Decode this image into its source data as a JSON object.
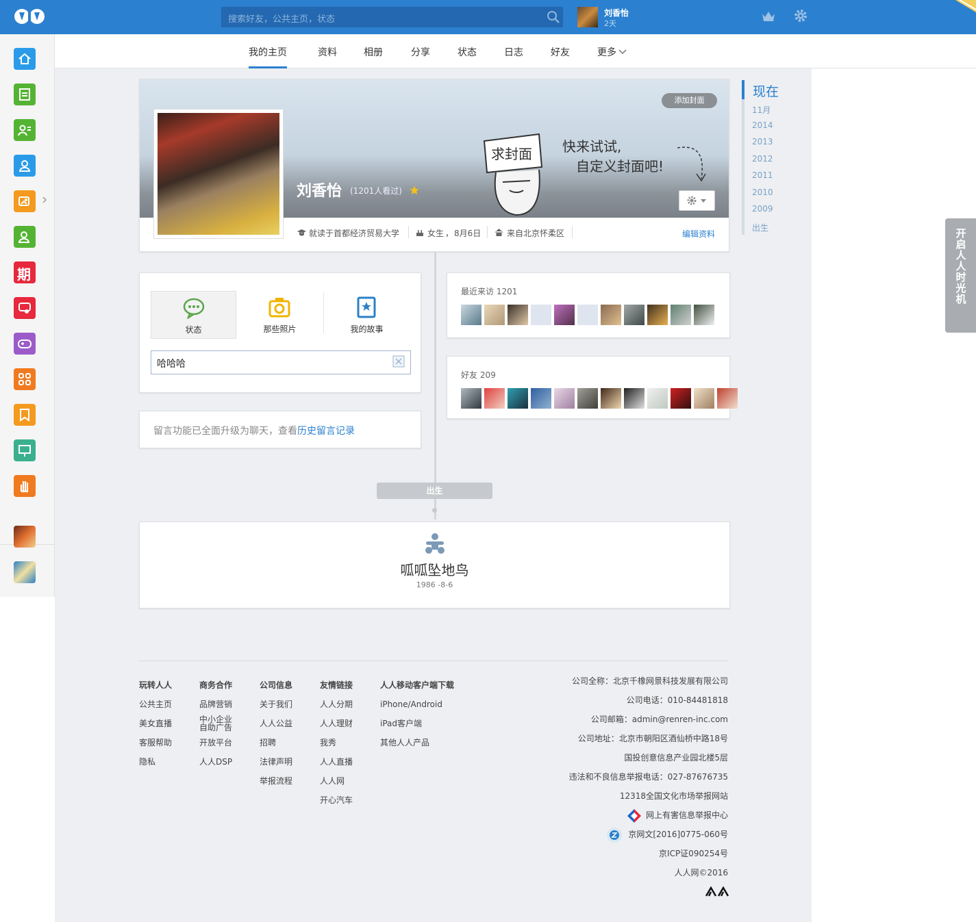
{
  "header": {
    "search_placeholder": "搜索好友，公共主页，状态",
    "user": {
      "name": "刘香怡",
      "status": "2天"
    }
  },
  "nav": {
    "tabs": [
      "我的主页",
      "资料",
      "相册",
      "分享",
      "状态",
      "日志",
      "好友",
      "更多"
    ],
    "active": "我的主页"
  },
  "sidebar": {
    "items": [
      {
        "icon": "home-icon",
        "color": "#2a9be8"
      },
      {
        "icon": "newsfeed-icon",
        "color": "#55b334"
      },
      {
        "icon": "profile-card-icon",
        "color": "#55b334"
      },
      {
        "icon": "friends-icon",
        "color": "#2a9be8"
      },
      {
        "icon": "photos-icon",
        "color": "#f39a1f"
      },
      {
        "icon": "contacts-icon",
        "color": "#55b334"
      },
      {
        "icon": "issue-icon",
        "color": "#e8283c",
        "label": "期"
      },
      {
        "icon": "message-icon",
        "color": "#e8283c"
      },
      {
        "icon": "game-icon",
        "color": "#9b5cc9"
      },
      {
        "icon": "apps-icon",
        "color": "#f07a1f"
      },
      {
        "icon": "bookmark-icon",
        "color": "#f39a1f"
      },
      {
        "icon": "present-icon",
        "color": "#3ab08e"
      },
      {
        "icon": "hand-icon",
        "color": "#f07a1f"
      },
      {
        "icon": "game-avatar-icon",
        "color": "#c0392b"
      },
      {
        "icon": "card-game-icon",
        "color": "#2a80c8"
      }
    ]
  },
  "cover": {
    "add_cover_label": "添加封面",
    "art_text_1": "求封面",
    "art_text_2": "快来试试,",
    "art_text_3": "自定义封面吧!",
    "name": "刘香怡",
    "views": "(1201人看过)",
    "info": {
      "school": "就读于首都经济贸易大学",
      "gender": "女生",
      "gender_sep": "，",
      "birthday": "8月6日",
      "hometown": "来自北京怀柔区"
    },
    "edit_label": "编辑资料"
  },
  "publisher": {
    "tabs": [
      {
        "label": "状态",
        "icon": "chat-bubble-icon"
      },
      {
        "label": "那些照片",
        "icon": "camera-icon"
      },
      {
        "label": "我的故事",
        "icon": "story-book-icon"
      }
    ],
    "input_value": "哈哈哈"
  },
  "message_notice": {
    "text": "留言功能已全面升级为聊天，查看",
    "link": "历史留言记录"
  },
  "visitors": {
    "title": "最近来访",
    "count": "1201"
  },
  "friends": {
    "title": "好友",
    "count": "209"
  },
  "birth": {
    "marker": "出生",
    "title": "呱呱坠地鸟",
    "date": "1986 -8-6"
  },
  "timeline_nav": {
    "now": "现在",
    "items": [
      "11月",
      "2014",
      "2013",
      "2012",
      "2011",
      "2010",
      "2009",
      "出生"
    ]
  },
  "side_tab": "开启人人时光机",
  "footer": {
    "columns": [
      {
        "heading": "玩转人人",
        "links": [
          "公共主页",
          "美女直播",
          "客服帮助",
          "隐私"
        ]
      },
      {
        "heading": "商务合作",
        "links": [
          "品牌营销",
          "中小企业 自助广告",
          "开放平台",
          "人人DSP"
        ]
      },
      {
        "heading": "公司信息",
        "links": [
          "关于我们",
          "人人公益",
          "招聘",
          "法律声明",
          "举报流程"
        ]
      },
      {
        "heading": "友情链接",
        "links": [
          "人人分期",
          "人人理财",
          "我秀",
          "人人直播",
          "人人网",
          "开心汽车"
        ]
      },
      {
        "heading": "人人移动客户端下载",
        "links": [
          "iPhone/Android",
          "iPad客户端",
          "其他人人产品"
        ]
      }
    ],
    "right": [
      "公司全称：北京千橡网景科技发展有限公司",
      "公司电话：010-84481818",
      "公司邮箱：admin@renren-inc.com",
      "公司地址：北京市朝阳区酒仙桥中路18号",
      "国投创意信息产业园北楼5层",
      "违法和不良信息举报电话：027-87676735",
      "12318全国文化市场举报网站",
      "网上有害信息举报中心",
      "京网文[2016]0775-060号",
      "京ICP证090254号",
      "人人网©2016"
    ]
  },
  "colors": {
    "brand": "#2b80cf",
    "background": "#edeff2"
  }
}
